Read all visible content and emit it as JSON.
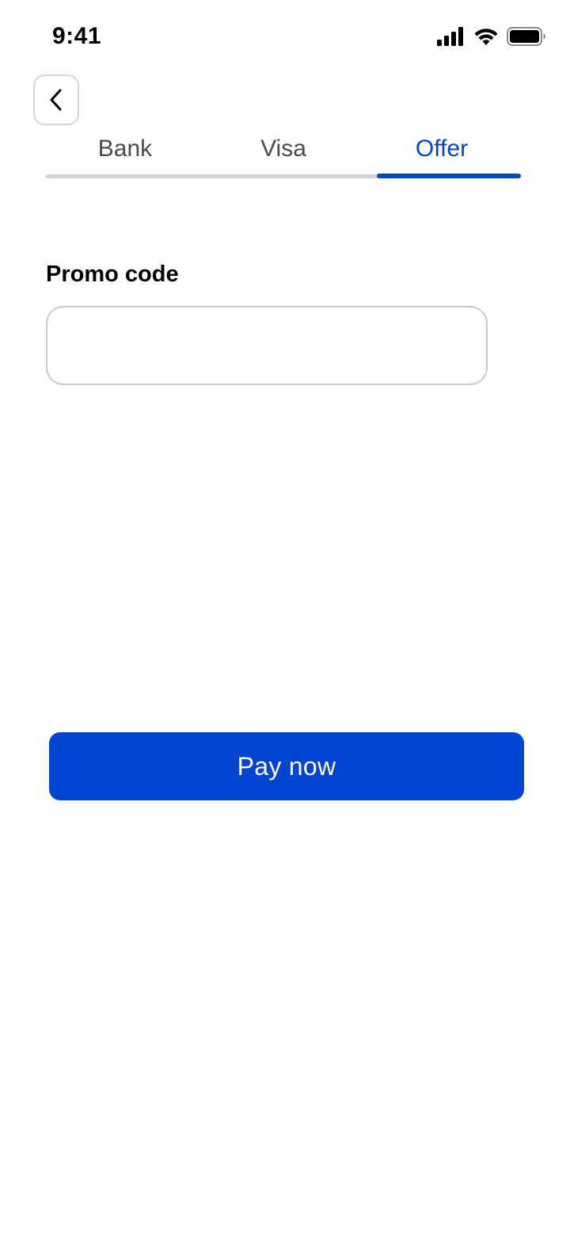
{
  "status_bar": {
    "time": "9:41",
    "icons": [
      "cellular-signal-icon",
      "wifi-icon",
      "battery-icon"
    ]
  },
  "back_button": {
    "icon": "chevron-left-icon"
  },
  "tabs": [
    {
      "label": "Bank",
      "active": false
    },
    {
      "label": "Visa",
      "active": false
    },
    {
      "label": "Offer",
      "active": true
    }
  ],
  "promo": {
    "label": "Promo code",
    "value": "",
    "placeholder": ""
  },
  "pay_button": {
    "label": "Pay now"
  },
  "colors": {
    "accent": "#0044d1",
    "tab_inactive": "#4a4a4a",
    "track": "#cfd3d9",
    "border": "#c9c9c9"
  }
}
